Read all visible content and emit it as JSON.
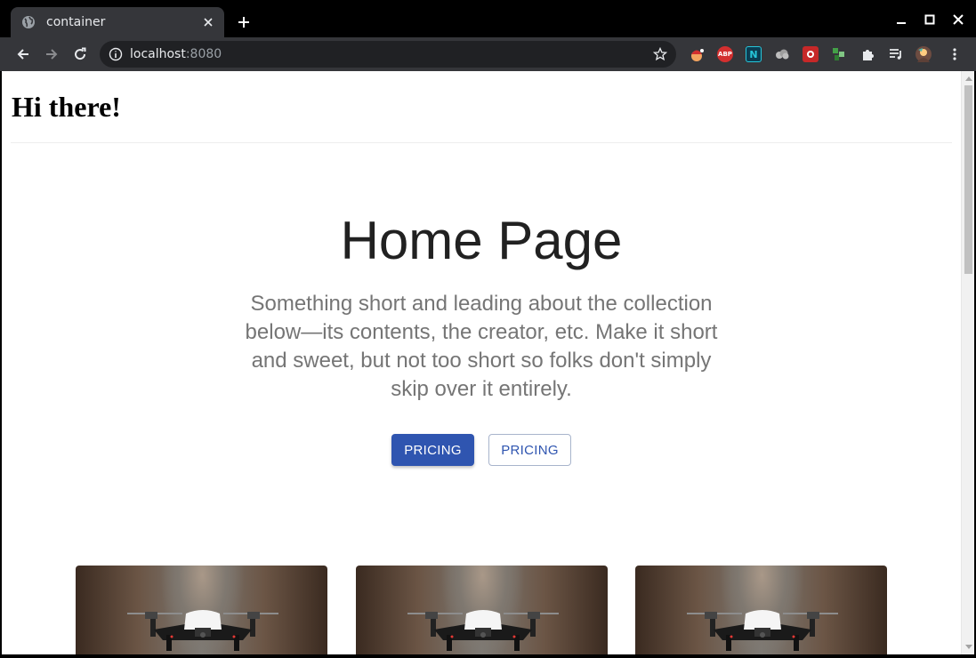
{
  "browser": {
    "tab": {
      "title": "container"
    },
    "address": {
      "host": "localhost",
      "port": ":8080"
    },
    "extensions": [
      "abp-extension-icon",
      "n-extension-icon",
      "cloud-extension-icon",
      "red-extension-icon",
      "green-extension-icon",
      "puzzle-extensions-icon",
      "media-queue-icon",
      "profile-avatar-icon"
    ],
    "extension_labels": {
      "abp": "ABP",
      "n": "N"
    }
  },
  "page": {
    "heading": "Hi there!",
    "hero": {
      "title": "Home Page",
      "subtitle": "Something short and leading about the collection below—its contents, the creator, etc. Make it short and sweet, but not too short so folks don't simply skip over it entirely.",
      "primary_button": "PRICING",
      "secondary_button": "PRICING"
    },
    "cards": [
      {
        "image": "drone-photo"
      },
      {
        "image": "drone-photo"
      },
      {
        "image": "drone-photo"
      }
    ]
  },
  "colors": {
    "primary": "#2f55b0",
    "toolbar": "#35363a",
    "heading": "#212121",
    "subtitle": "#757575"
  }
}
